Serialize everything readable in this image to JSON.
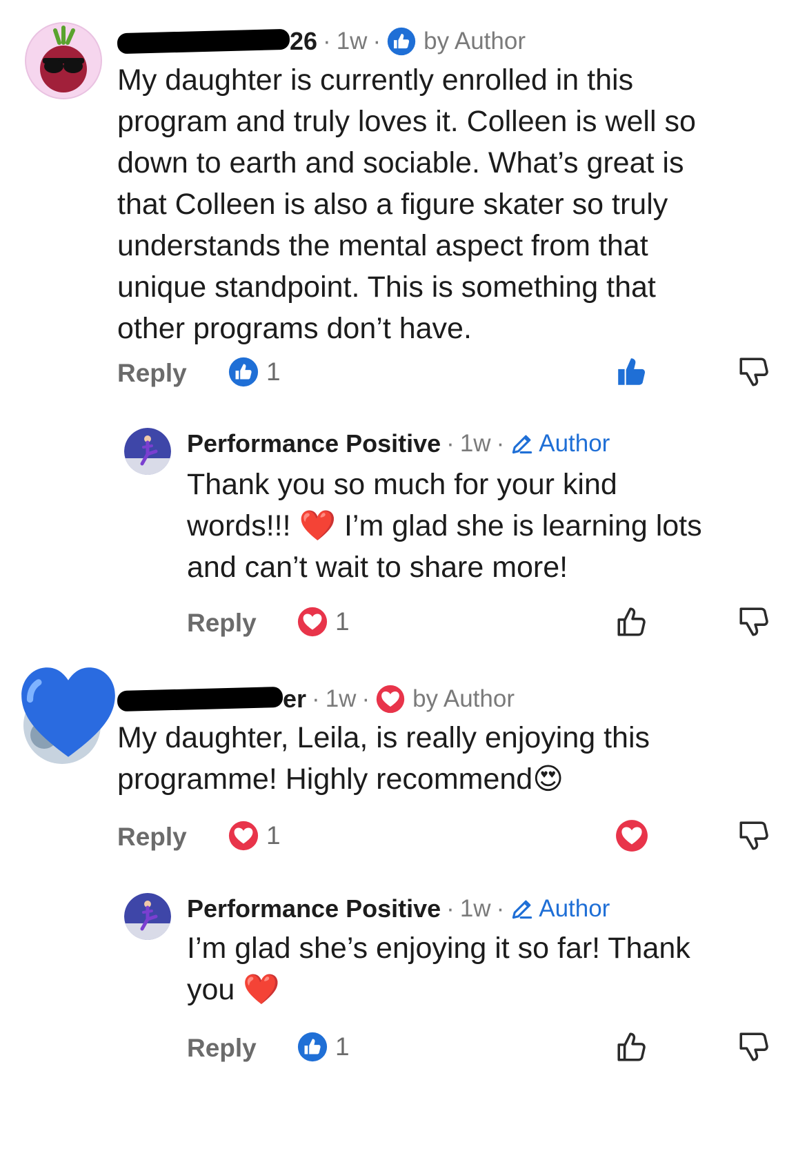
{
  "colors": {
    "like_blue": "#1f6fd6",
    "heart_red": "#e8344a",
    "author_blue": "#1f6fd6",
    "muted": "#7a7a7a"
  },
  "comments": [
    {
      "author_visible_suffix": "26",
      "time": "1w",
      "badge_icon": "like-icon",
      "badge_label": "by Author",
      "body_lines": [
        "My daughter is currently enrolled in this",
        "program and truly loves it. Colleen is well so",
        "down to earth and sociable. What’s great is",
        "that Colleen is also a figure skater so truly",
        "understands the mental aspect from that",
        "unique standpoint.  This is something that",
        "other programs don’t have."
      ],
      "reply_label": "Reply",
      "reaction_icon": "like-icon",
      "reaction_count": "1"
    },
    {
      "author": "Performance Positive",
      "time": "1w",
      "badge_label": "Author",
      "body_lines": [
        "Thank you so much for your kind",
        "words!!! ❤️ I’m glad she is learning lots",
        "and can’t wait to share more!"
      ],
      "reply_label": "Reply",
      "reaction_icon": "heart-icon",
      "reaction_count": "1"
    },
    {
      "author_visible_suffix": "er",
      "time": "1w",
      "badge_icon": "heart-icon",
      "badge_label": "by Author",
      "body_lines": [
        "My daughter, Leila, is really enjoying this",
        "programme! Highly recommend😍"
      ],
      "reply_label": "Reply",
      "reaction_icon": "heart-icon",
      "reaction_count": "1"
    },
    {
      "author": "Performance Positive",
      "time": "1w",
      "badge_label": "Author",
      "body_lines": [
        "I’m glad she’s enjoying it so far! Thank",
        "you ❤️"
      ],
      "reply_label": "Reply",
      "reaction_icon": "like-icon",
      "reaction_count": "1"
    }
  ]
}
